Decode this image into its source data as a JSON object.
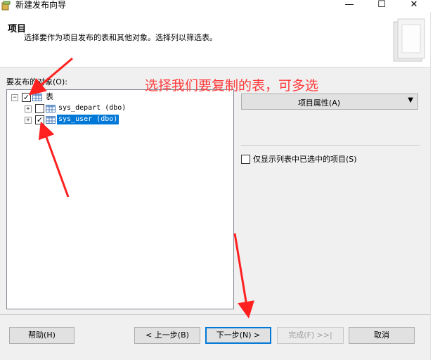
{
  "window": {
    "title": "新建发布向导",
    "minimize": "—",
    "maximize": "☐",
    "close": "✕"
  },
  "header": {
    "title": "项目",
    "description": "选择要作为项目发布的表和其他对象。选择列以筛选表。"
  },
  "objects_label": "要发布的对象(O):",
  "tree": {
    "root": {
      "label": "表",
      "checked": true,
      "expander": "−"
    },
    "items": [
      {
        "label": "sys_depart (dbo)",
        "checked": false,
        "expander": "+"
      },
      {
        "label": "sys_user (dbo)",
        "checked": true,
        "expander": "+",
        "selected": true
      }
    ]
  },
  "item_properties_button": "项目属性(A)",
  "dropdown_arrow": "▼",
  "only_selected_checkbox": {
    "label": "仅显示列表中已选中的项目(S)",
    "checked": false
  },
  "annotation": "选择我们要复制的表，可多选",
  "footer": {
    "help": "帮助(H)",
    "back": "< 上一步(B)",
    "next": "下一步(N) >",
    "finish": "完成(F) >>|",
    "cancel": "取消"
  },
  "colors": {
    "selection": "#0078d7",
    "annotation": "#ff3b3b"
  }
}
